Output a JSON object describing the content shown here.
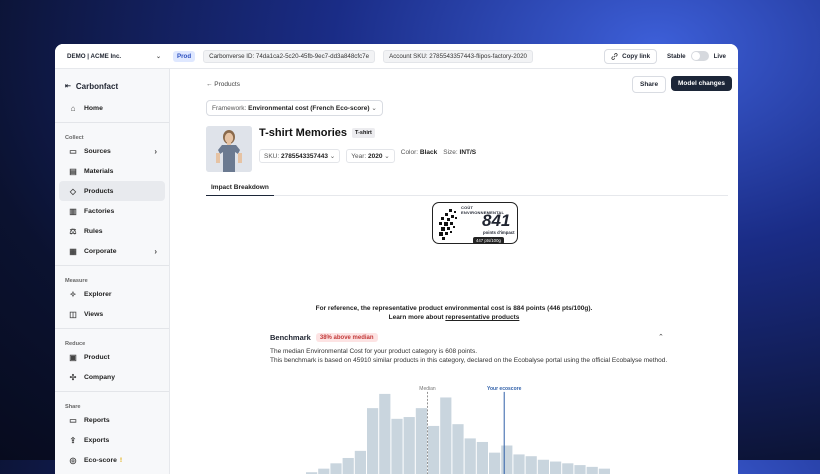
{
  "topbar": {
    "org": "DEMO | ACME Inc.",
    "env": "Prod",
    "carbonverse_id": "Carbonverse ID: 74da1ca2-5c20-45fb-9ec7-dd3a848cfc7e",
    "account_sku": "Account SKU: 2785543357443-flipos-factory-2020",
    "copy_link": "Copy link",
    "stable": "Stable",
    "live": "Live"
  },
  "sidebar": {
    "logo": "Carbonfact",
    "home": "Home",
    "sections": {
      "collect": "Collect",
      "measure": "Measure",
      "reduce": "Reduce",
      "share": "Share"
    },
    "collect_items": [
      "Sources",
      "Materials",
      "Products",
      "Factories",
      "Rules",
      "Corporate"
    ],
    "measure_items": [
      "Explorer",
      "Views"
    ],
    "reduce_items": [
      "Product",
      "Company"
    ],
    "share_items": [
      "Reports",
      "Exports",
      "Eco-score"
    ]
  },
  "main": {
    "breadcrumb": "← Products",
    "share": "Share",
    "model_changes": "Model changes",
    "framework_label": "Framework:",
    "framework_value": "Environmental cost (French Eco-score)",
    "title": "T-shirt Memories",
    "title_tag": "T-shirt",
    "sku_label": "SKU:",
    "sku_value": "2785543357443",
    "year_label": "Year:",
    "year_value": "2020",
    "color_label": "Color:",
    "color_value": "Black",
    "size_label": "Size:",
    "size_value": "INT/S",
    "tab": "Impact Breakdown",
    "score": {
      "header": "COÛT ENVIRONNEMENTAL",
      "value": "841",
      "unit": "points d'impact",
      "per100g": "447 pts/100g"
    },
    "reference_line": "For reference, the representative product environmental cost is 884 points (446 pts/100g).",
    "learn_more_prefix": "Learn more about ",
    "learn_more_link": "representative products",
    "benchmark": {
      "title": "Benchmark",
      "badge": "38% above median",
      "line1": "The median Environmental Cost for your product category is 608 points.",
      "line2": "This benchmark is based on 45910 similar products in this category, declared on the Ecobalyse portal using the official Ecobalyse method.",
      "median_label": "Median",
      "ecoscore_label": "Your ecoscore"
    }
  },
  "chart_data": {
    "type": "bar",
    "values": [
      1,
      3,
      6,
      9,
      13,
      37,
      45,
      31,
      32,
      37,
      27,
      43,
      28,
      20,
      18,
      12,
      16,
      11,
      10,
      8,
      7,
      6,
      5,
      4,
      3
    ],
    "median_index": 10,
    "score_index": 16,
    "colors": {
      "bar": "#c9d5de",
      "median": "#777777",
      "score": "#2f5fa8"
    }
  },
  "colors": {
    "accent": "#1c2638",
    "badge_bg": "#fde3e3",
    "badge_fg": "#c23a3a"
  }
}
